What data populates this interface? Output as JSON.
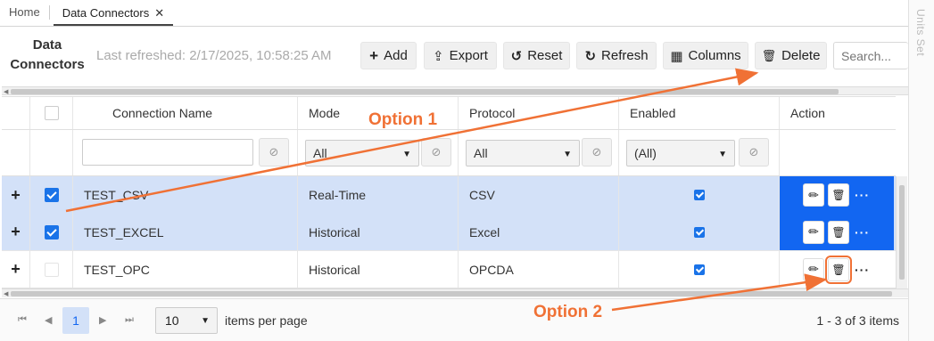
{
  "tabs": [
    {
      "label": "Home"
    },
    {
      "label": "Data Connectors",
      "close": "✕"
    }
  ],
  "side_panel": {
    "label": "Units Set"
  },
  "page": {
    "title": "Data Connectors",
    "last_refreshed": "Last refreshed: 2/17/2025, 10:58:25 AM"
  },
  "toolbar": {
    "add": {
      "label": "Add",
      "icon": "+"
    },
    "export": {
      "label": "Export",
      "icon": "⇪"
    },
    "reset": {
      "label": "Reset",
      "icon": "↺"
    },
    "refresh": {
      "label": "Refresh",
      "icon": "↻"
    },
    "columns": {
      "label": "Columns",
      "icon": "▦"
    },
    "delete": {
      "label": "Delete",
      "icon": "🗑"
    },
    "search_placeholder": "Search..."
  },
  "grid": {
    "columns": [
      "Connection Name",
      "Mode",
      "Protocol",
      "Enabled",
      "Action"
    ],
    "filters": {
      "connection_name": "",
      "mode": "All",
      "protocol": "All",
      "enabled": "(All)"
    },
    "rows": [
      {
        "name": "TEST_CSV",
        "mode": "Real-Time",
        "protocol": "CSV",
        "enabled": true,
        "selected": true
      },
      {
        "name": "TEST_EXCEL",
        "mode": "Historical",
        "protocol": "Excel",
        "enabled": true,
        "selected": true
      },
      {
        "name": "TEST_OPC",
        "mode": "Historical",
        "protocol": "OPCDA",
        "enabled": true,
        "selected": false
      }
    ],
    "expand_symbol": "+",
    "more_symbol": "···"
  },
  "pager": {
    "current_page": "1",
    "page_size": "10",
    "per_page_label": "items per page",
    "count": "1 - 3 of 3 items"
  },
  "annotations": {
    "option1": "Option 1",
    "option2": "Option 2",
    "color": "#f07135"
  },
  "colors": {
    "selected_row": "#d3e1f8",
    "action_highlight": "#1266f1",
    "checkbox": "#1a73e8"
  }
}
